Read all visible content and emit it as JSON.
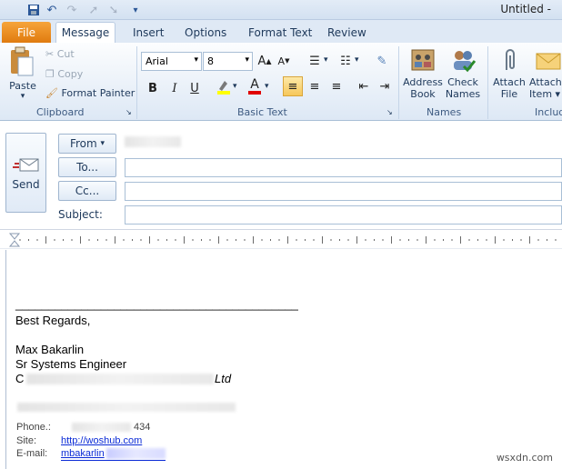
{
  "window": {
    "title": "Untitled - "
  },
  "qat": {
    "icons": [
      "save-icon",
      "undo-icon",
      "redo-icon",
      "up-arrow-icon",
      "down-arrow-icon",
      "customize-icon"
    ]
  },
  "tabs": [
    "File",
    "Message",
    "Insert",
    "Options",
    "Format Text",
    "Review"
  ],
  "clipboard": {
    "paste": "Paste",
    "cut": "Cut",
    "copy": "Copy",
    "format_painter": "Format Painter",
    "group": "Clipboard"
  },
  "basic_text": {
    "font": "Arial",
    "size": "8",
    "bold": "B",
    "italic": "I",
    "underline": "U",
    "group": "Basic Text"
  },
  "names": {
    "address_book_1": "Address",
    "address_book_2": "Book",
    "check_names_1": "Check",
    "check_names_2": "Names",
    "group": "Names"
  },
  "include": {
    "attach_file_1": "Attach",
    "attach_file_2": "File",
    "attach_item_1": "Attach",
    "attach_item_2": "Item ▾",
    "group": "Includ"
  },
  "header": {
    "send": "Send",
    "from": "From",
    "to": "To...",
    "cc": "Cc...",
    "subject": "Subject:"
  },
  "body": {
    "line": "___________________________________________",
    "regards": "Best Regards,",
    "name": "Max Bakarlin",
    "role": "Sr Systems Engineer",
    "company_first": "C",
    "company_suffix": "Ltd",
    "phone_label": "Phone.:",
    "phone_tail": "434",
    "site_label": "Site:",
    "site_url": "http://woshub.com",
    "email_label": "E-mail:",
    "email_value": "mbakarlin"
  },
  "watermark": "wsxdn.com"
}
